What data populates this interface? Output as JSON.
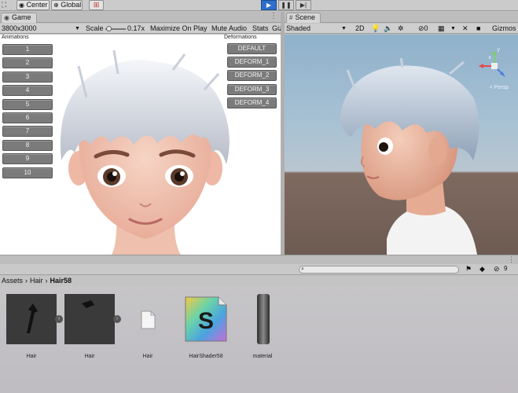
{
  "toolbar": {
    "center_label": "Center",
    "global_label": "Global",
    "play_icon": "play-icon",
    "pause_icon": "pause-icon",
    "step_icon": "step-icon"
  },
  "game": {
    "tab_label": "Game",
    "resolution": "3800x3000",
    "scale_label": "Scale",
    "scale_value": "0.17x",
    "maximize_label": "Maximize On Play",
    "mute_label": "Mute Audio",
    "stats_label": "Stats",
    "gizmos_label": "Giz",
    "animations_caption": "Animations",
    "deformations_caption": "Deformations",
    "animation_buttons": [
      "1",
      "2",
      "3",
      "4",
      "5",
      "6",
      "7",
      "8",
      "9",
      "10"
    ],
    "deform_buttons": [
      "DEFAULT",
      "DEFORM_1",
      "DEFORM_2",
      "DEFORM_3",
      "DEFORM_4"
    ]
  },
  "scene": {
    "tab_label": "Scene",
    "shading_mode": "Shaded",
    "mode_2d": "2D",
    "hidden_count": "0",
    "gizmos_label": "Gizmos",
    "persp_label": "< Persp",
    "axis_x": "x",
    "axis_y": "y"
  },
  "project": {
    "breadcrumb": [
      "Assets",
      "Hair",
      "Hair58"
    ],
    "hidden_count": "9",
    "assets": [
      {
        "label": "Hair",
        "icon": "hair-model-icon"
      },
      {
        "label": "Hair",
        "icon": "hair-mesh-icon"
      },
      {
        "label": "Hair",
        "icon": "file-icon"
      },
      {
        "label": "HairShader58",
        "icon": "shader-icon"
      },
      {
        "label": "material",
        "icon": "material-icon"
      }
    ]
  },
  "colors": {
    "accent_play": "#2f6fcb",
    "ui_button": "#7b7b7b",
    "shader_gradient": [
      "#f5c842",
      "#6bd3a8",
      "#4aa3e0",
      "#c86bd8"
    ]
  }
}
